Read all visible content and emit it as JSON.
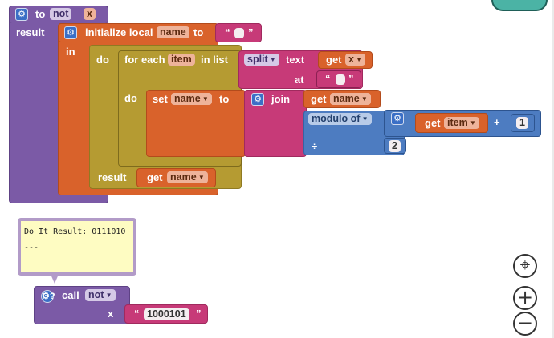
{
  "procedure": {
    "keyword_to": "to",
    "name": "not",
    "param": "x",
    "result_label": "result"
  },
  "init_local": {
    "label": "initialize local",
    "var": "name",
    "to": "to",
    "empty_quote_open": "“",
    "empty_quote_close": "”",
    "in_label": "in"
  },
  "do_block": {
    "do_label": "do",
    "result_label": "result"
  },
  "foreach": {
    "label": "for each",
    "item": "item",
    "in_list": "in list",
    "do_label": "do"
  },
  "split": {
    "label": "split",
    "text_label": "text",
    "at_label": "at",
    "get_label": "get",
    "get_var": "x"
  },
  "set_block": {
    "label": "set",
    "var": "name",
    "to": "to"
  },
  "join": {
    "label": "join",
    "get_label": "get",
    "get_var": "name"
  },
  "math": {
    "op": "modulo of",
    "get_label": "get",
    "get_var": "item",
    "plus": "+",
    "number_one": "1",
    "divide": "÷",
    "number_two": "2"
  },
  "result_get": {
    "get_label": "get",
    "var": "name"
  },
  "bubble": {
    "line1": "Do It Result: 0111010",
    "line2": "---"
  },
  "call_block": {
    "label": "call",
    "proc": "not",
    "param": "x",
    "quote_open": "“",
    "value": "1000101",
    "quote_close": "”",
    "help": "?"
  },
  "controls": {
    "center": "⌖",
    "zoom_in": "+",
    "zoom_out": "−"
  },
  "colors": {
    "procedure": "#7b5aa6",
    "variables": "#d9622b",
    "control": "#b59b32",
    "text": "#c73a78",
    "math": "#4d7cc1"
  }
}
